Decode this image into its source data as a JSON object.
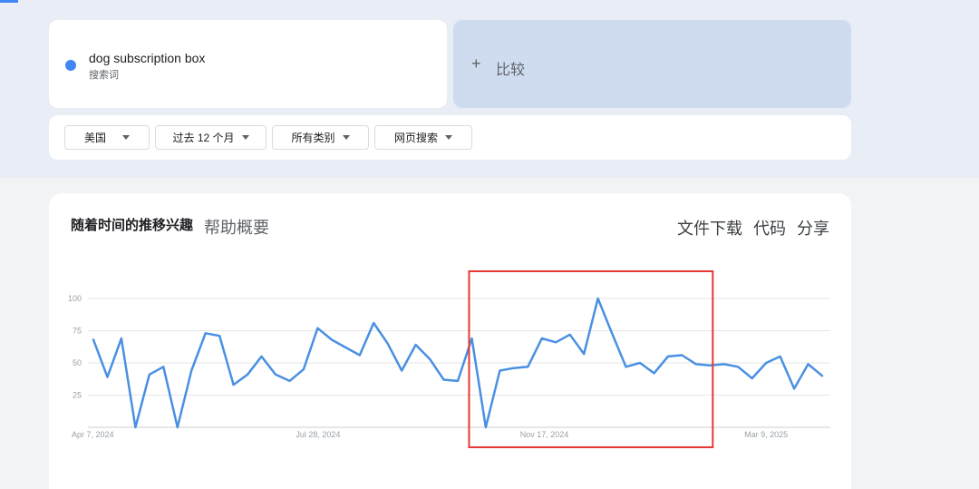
{
  "search": {
    "term": "dog subscription box",
    "term_type": "搜索词",
    "term_color": "#4285f4",
    "compare_plus": "+",
    "compare_label": "比较"
  },
  "filters": [
    {
      "label": "美国"
    },
    {
      "label": "过去 12 个月"
    },
    {
      "label": "所有类别"
    },
    {
      "label": "网页搜索"
    }
  ],
  "panel": {
    "title": "随着时间的推移兴趣",
    "help": "帮助概要",
    "actions": [
      "文件下载",
      "代码",
      "分享"
    ]
  },
  "chart_data": {
    "type": "line",
    "title": "",
    "xlabel": "",
    "ylabel": "",
    "ylim": [
      0,
      100
    ],
    "yticks": [
      25,
      50,
      75,
      100
    ],
    "xtick_labels": [
      {
        "label": "Apr 7, 2024",
        "index": 0
      },
      {
        "label": "Jul 28, 2024",
        "index": 16
      },
      {
        "label": "Nov 17, 2024",
        "index": 32
      },
      {
        "label": "Mar 9, 2025",
        "index": 48
      }
    ],
    "grid": true,
    "line_color": "#4a90e2",
    "highlight": {
      "from_index": 27,
      "to_index": 44,
      "color": "#e53935"
    },
    "series": [
      {
        "values": [
          68,
          39,
          69,
          0,
          41,
          47,
          0,
          44,
          73,
          71,
          33,
          41,
          55,
          41,
          36,
          45,
          77,
          68,
          62,
          56,
          81,
          65,
          44,
          64,
          53,
          37,
          36,
          69,
          0,
          44,
          46,
          47,
          69,
          66,
          72,
          57,
          100,
          73,
          47,
          50,
          42,
          55,
          56,
          49,
          48,
          49,
          47,
          38,
          50,
          55,
          30,
          49,
          40
        ]
      }
    ]
  }
}
